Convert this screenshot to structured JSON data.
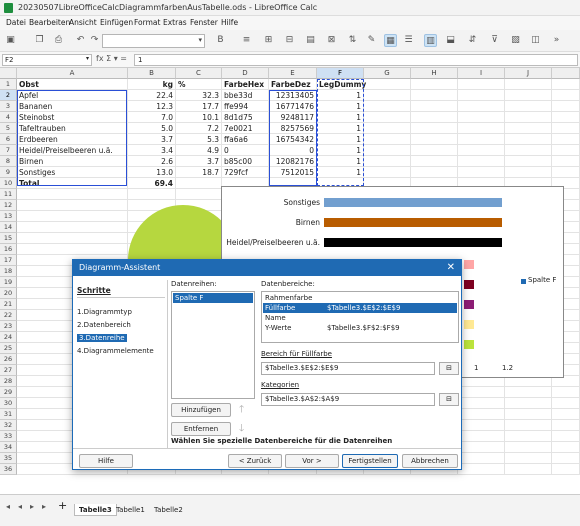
{
  "title": "20230507LibreOfficeCalcDiagrammfarbenAusTabelle.ods - LibreOffice Calc",
  "menu": [
    "Datei",
    "Bearbeiten",
    "Ansicht",
    "Einfügen",
    "Format",
    "Extras",
    "Fenster",
    "Hilfe"
  ],
  "namebox": "F2",
  "formula": "1",
  "fx": "fx Σ ▾ =",
  "columns": [
    "A",
    "B",
    "C",
    "D",
    "E",
    "F",
    "G",
    "H",
    "I",
    "J"
  ],
  "rows": [
    "1",
    "2",
    "3",
    "4",
    "5",
    "6",
    "7",
    "8",
    "9",
    "10",
    "11",
    "12",
    "13",
    "14",
    "15",
    "16",
    "17",
    "18",
    "19",
    "20",
    "21",
    "22",
    "23",
    "24",
    "25",
    "26",
    "27",
    "28",
    "29",
    "30",
    "31",
    "32",
    "33",
    "34",
    "35",
    "36"
  ],
  "table": {
    "header": [
      "Obst",
      "kg",
      "%",
      "FarbeHex",
      "FarbeDez",
      "LegDummy"
    ],
    "rows": [
      [
        "Apfel",
        "22.4",
        "32.3",
        "bbe33d",
        "12313405",
        "1"
      ],
      [
        "Bananen",
        "12.3",
        "17.7",
        "ffe994",
        "16771476",
        "1"
      ],
      [
        "Steinobst",
        "7.0",
        "10.1",
        "8d1d75",
        "9248117",
        "1"
      ],
      [
        "Tafeltrauben",
        "5.0",
        "7.2",
        "7e0021",
        "8257569",
        "1"
      ],
      [
        "Erdbeeren",
        "3.7",
        "5.3",
        "ffa6a6",
        "16754342",
        "1"
      ],
      [
        "Heidel/Preiselbeeren u.ä.",
        "3.4",
        "4.9",
        "0",
        "0",
        "1"
      ],
      [
        "Birnen",
        "2.6",
        "3.7",
        "b85c00",
        "12082176",
        "1"
      ],
      [
        "Sonstiges",
        "13.0",
        "18.7",
        "729fcf",
        "7512015",
        "1"
      ]
    ],
    "total_label": "Total",
    "total_value": "69.4"
  },
  "chart": {
    "labels": [
      "Sonstiges",
      "Birnen",
      "Heidel/Preiselbeeren u.ä."
    ],
    "colors": [
      "#729fcf",
      "#b85c00",
      "#000000"
    ],
    "small_colors": [
      "#ffa6a6",
      "#7e0021",
      "#8d1d75",
      "#ffe994",
      "#bbe33d"
    ],
    "legend": "Spalte F",
    "ticks": [
      "1",
      "1.2"
    ]
  },
  "dialog": {
    "title": "Diagramm-Assistent",
    "steps_header": "Schritte",
    "steps": [
      "1.Diagrammtyp",
      "2.Datenbereich",
      "3.Datenreihe",
      "4.Diagrammelemente"
    ],
    "series_label": "Datenreihen:",
    "series": [
      "Spalte F"
    ],
    "ranges_label": "Datenbereiche:",
    "ranges": [
      [
        "Rahmenfarbe",
        ""
      ],
      [
        "Füllfarbe",
        "$Tabelle3.$E$2:$E$9"
      ],
      [
        "Name",
        ""
      ],
      [
        "Y-Werte",
        "$Tabelle3.$F$2:$F$9"
      ]
    ],
    "fill_label": "Bereich für Füllfarbe",
    "fill_value": "$Tabelle3.$E$2:$E$9",
    "cat_label": "Kategorien",
    "cat_value": "$Tabelle3.$A$2:$A$9",
    "add": "Hinzufügen",
    "remove": "Entfernen",
    "hint": "Wählen Sie spezielle Datenbereiche für die Datenreihen",
    "help": "Hilfe",
    "back": "< Zurück",
    "next": "Vor >",
    "finish": "Fertigstellen",
    "cancel": "Abbrechen"
  },
  "sheets": [
    "Tabelle3",
    "Tabelle1",
    "Tabelle2"
  ]
}
